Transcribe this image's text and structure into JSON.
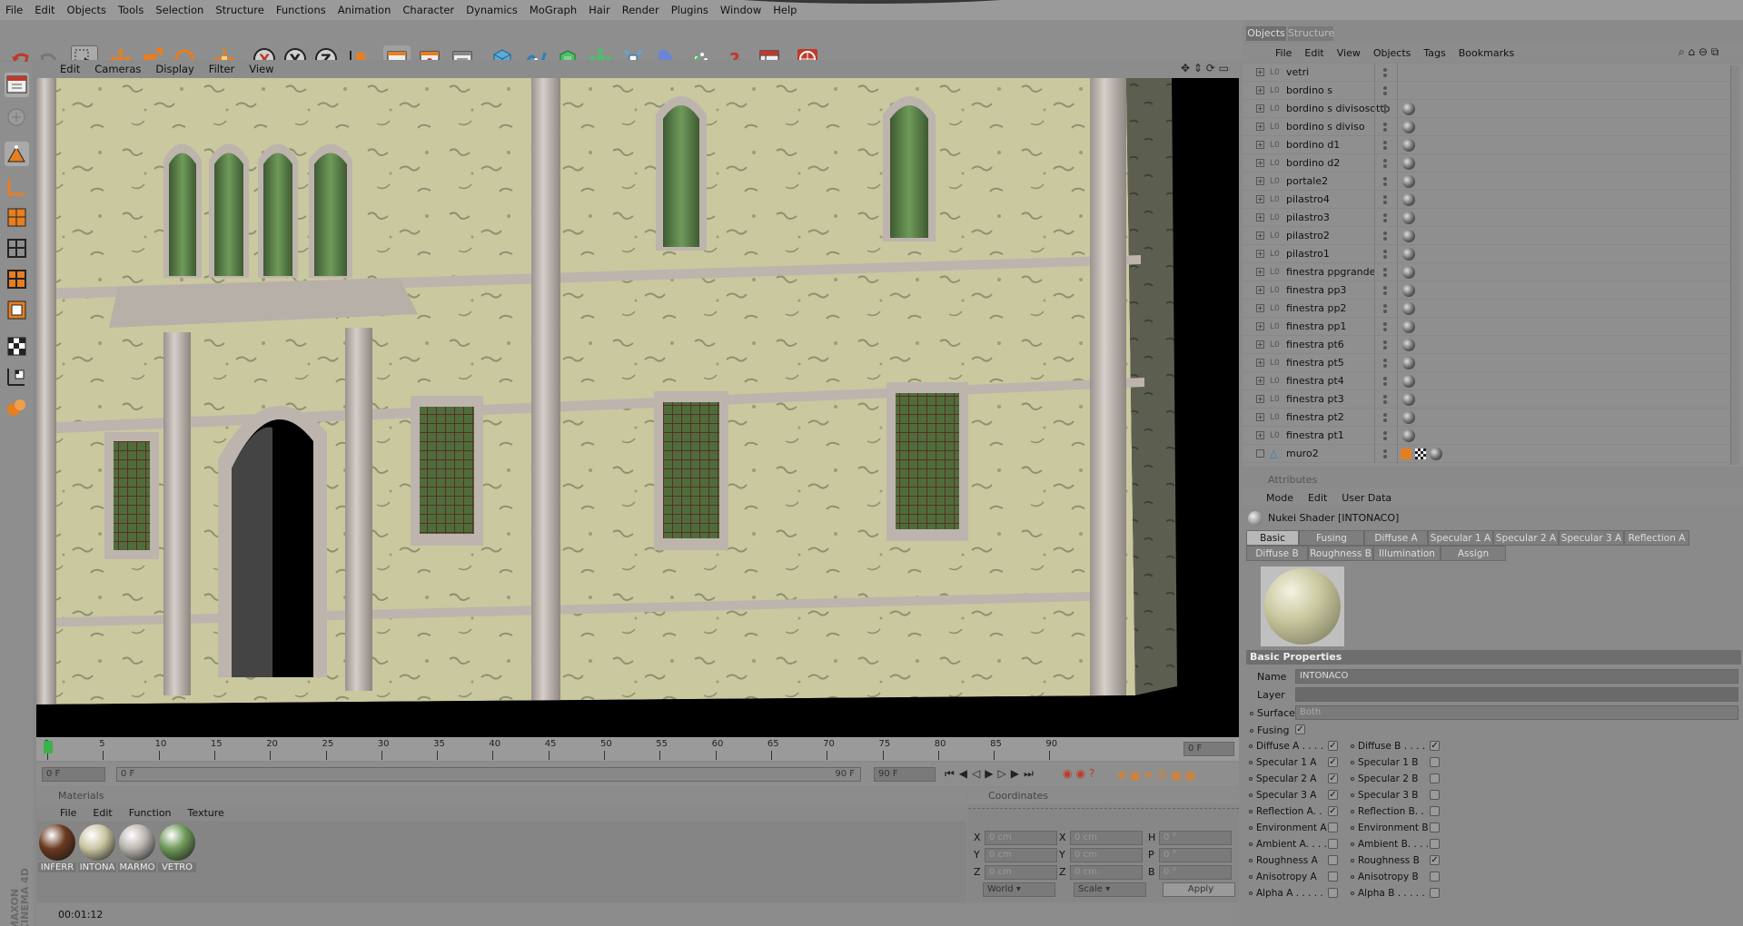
{
  "menubar": [
    "File",
    "Edit",
    "Objects",
    "Tools",
    "Selection",
    "Structure",
    "Functions",
    "Animation",
    "Character",
    "Dynamics",
    "MoGraph",
    "Hair",
    "Render",
    "Plugins",
    "Window",
    "Help"
  ],
  "viewport_menu": [
    "Edit",
    "Cameras",
    "Display",
    "Filter",
    "View"
  ],
  "timeline": {
    "ticks": [
      "0",
      "5",
      "10",
      "15",
      "20",
      "25",
      "30",
      "35",
      "40",
      "45",
      "50",
      "55",
      "60",
      "65",
      "70",
      "75",
      "80",
      "85",
      "90"
    ],
    "current_frame": "0 F",
    "start_field": "0 F",
    "min_field": "0 F",
    "max_field": "90 F",
    "end_field": "90 F"
  },
  "materials": {
    "title": "Materials",
    "menu": [
      "File",
      "Edit",
      "Function",
      "Texture"
    ],
    "items": [
      {
        "label": "INFERR",
        "color": "#6b3a22"
      },
      {
        "label": "INTONA",
        "color": "#c9c6a2"
      },
      {
        "label": "MARMO",
        "color": "#bbb5b0"
      },
      {
        "label": "VETRO",
        "color": "#6f9a5a"
      }
    ]
  },
  "coordinates": {
    "title": "Coordinates",
    "col1": [
      "X",
      "Y",
      "Z"
    ],
    "col2": [
      "X",
      "Y",
      "Z"
    ],
    "col3": [
      "H",
      "P",
      "B"
    ],
    "pos_vals": [
      "0 cm",
      "0 cm",
      "0 cm"
    ],
    "size_vals": [
      "0 cm",
      "0 cm",
      "0 cm"
    ],
    "rot_vals": [
      "0 °",
      "0 °",
      "0 °"
    ],
    "dropdown1": "World",
    "dropdown2": "Scale",
    "apply": "Apply"
  },
  "status": {
    "time": "00:01:12"
  },
  "brand": {
    "line1": "MAXON",
    "line2": "CINEMA 4D"
  },
  "object_manager": {
    "tabs": [
      "Objects",
      "Structure"
    ],
    "menu": [
      "File",
      "Edit",
      "View",
      "Objects",
      "Tags",
      "Bookmarks"
    ],
    "objects": [
      {
        "name": "vetri",
        "has_material": false
      },
      {
        "name": "bordino s",
        "has_material": false
      },
      {
        "name": "bordino s divisosotto",
        "has_material": true
      },
      {
        "name": "bordino s diviso",
        "has_material": true
      },
      {
        "name": "bordino d1",
        "has_material": true
      },
      {
        "name": "bordino d2",
        "has_material": true
      },
      {
        "name": "portale2",
        "has_material": true
      },
      {
        "name": "pilastro4",
        "has_material": true
      },
      {
        "name": "pilastro3",
        "has_material": true
      },
      {
        "name": "pilastro2",
        "has_material": true
      },
      {
        "name": "pilastro1",
        "has_material": true
      },
      {
        "name": "finestra ppgrande",
        "has_material": true
      },
      {
        "name": "finestra pp3",
        "has_material": true
      },
      {
        "name": "finestra pp2",
        "has_material": true
      },
      {
        "name": "finestra pp1",
        "has_material": true
      },
      {
        "name": "finestra pt6",
        "has_material": true
      },
      {
        "name": "finestra pt5",
        "has_material": true
      },
      {
        "name": "finestra pt4",
        "has_material": true
      },
      {
        "name": "finestra pt3",
        "has_material": true
      },
      {
        "name": "finestra pt2",
        "has_material": true
      },
      {
        "name": "finestra pt1",
        "has_material": true
      },
      {
        "name": "muro2",
        "has_material": true
      }
    ]
  },
  "attributes": {
    "title": "Attributes",
    "menu": [
      "Mode",
      "Edit",
      "User Data"
    ],
    "shader_title": "Nukei Shader [INTONACO]",
    "tabs_row1": [
      "Basic",
      "Fusing",
      "Diffuse A",
      "Specular 1 A",
      "Specular 2 A",
      "Specular 3 A",
      "Reflection A"
    ],
    "tabs_row2": [
      "Diffuse B",
      "Roughness B",
      "Illumination",
      "Assign"
    ],
    "section": "Basic Properties",
    "name_label": "Name",
    "name_value": "INTONACO",
    "layer_label": "Layer",
    "surface_label": "Surface",
    "surface_value": "Both",
    "fusing_label": "Fusing",
    "left_checks": [
      {
        "label": "Diffuse A . . . .",
        "checked": true
      },
      {
        "label": "Specular 1 A",
        "checked": true
      },
      {
        "label": "Specular 2 A",
        "checked": true
      },
      {
        "label": "Specular 3 A",
        "checked": true
      },
      {
        "label": "Reflection A. .",
        "checked": true
      },
      {
        "label": "Environment A",
        "checked": false
      },
      {
        "label": "Ambient A. . . .",
        "checked": false
      },
      {
        "label": "Roughness A",
        "checked": false
      },
      {
        "label": "Anisotropy A",
        "checked": false
      },
      {
        "label": "Alpha A . . . . .",
        "checked": false
      }
    ],
    "right_checks": [
      {
        "label": "Diffuse B . . . .",
        "checked": true
      },
      {
        "label": "Specular 1 B",
        "checked": false
      },
      {
        "label": "Specular 2 B",
        "checked": false
      },
      {
        "label": "Specular 3 B",
        "checked": false
      },
      {
        "label": "Reflection B. .",
        "checked": false
      },
      {
        "label": "Environment B",
        "checked": false
      },
      {
        "label": "Ambient B. . . .",
        "checked": false
      },
      {
        "label": "Roughness B",
        "checked": true
      },
      {
        "label": "Anisotropy B",
        "checked": false
      },
      {
        "label": "Alpha B . . . . .",
        "checked": false
      }
    ]
  },
  "colors": {
    "wall": "#c9c89f",
    "stone": "#bdb4ad",
    "glass": "#4f6d3c",
    "accent_active": "#3cb34a"
  }
}
